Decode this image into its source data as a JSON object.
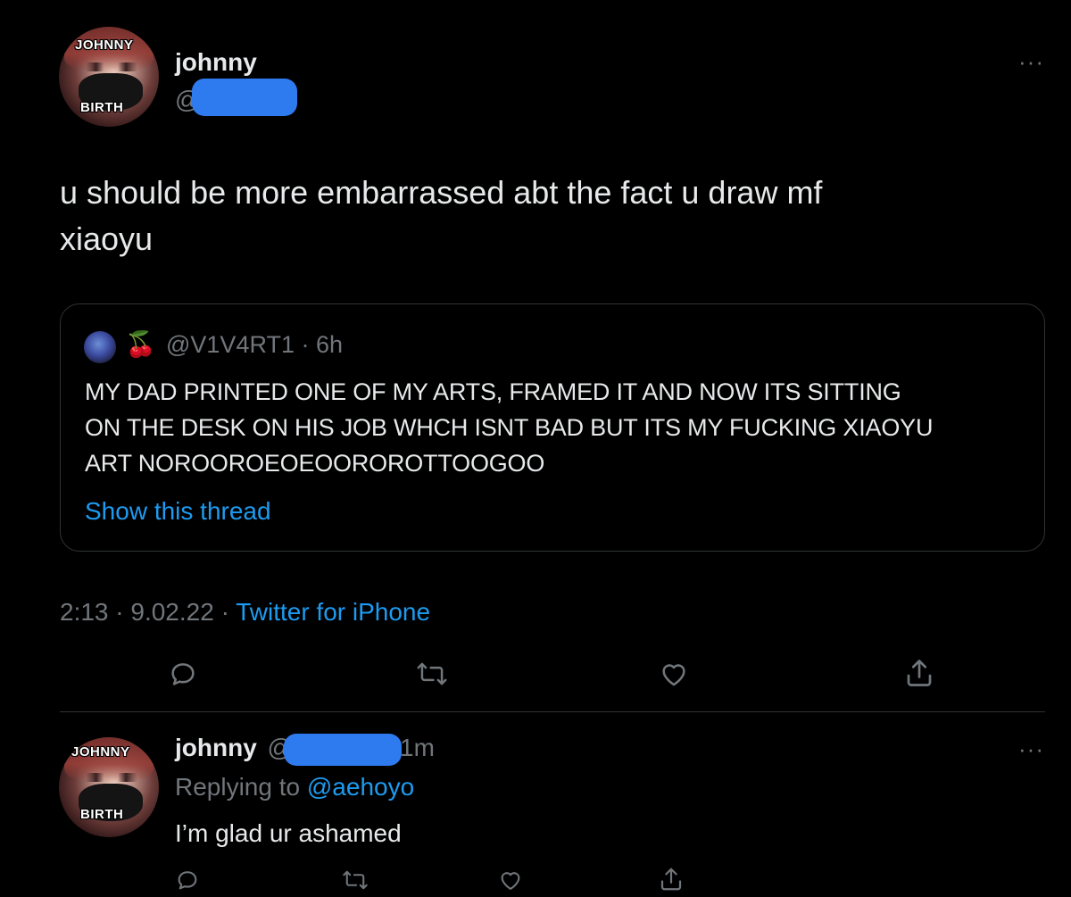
{
  "main_tweet": {
    "avatar_text_top": "JOHNNY",
    "avatar_text_bottom": "BIRTH",
    "display_name": "johnny",
    "handle_prefix": "@",
    "text_line1": "u should be more embarrassed abt the fact u draw mf",
    "text_line2": "xiaoyu",
    "timestamp": "2:13 · 9.02.22 · ",
    "source": "Twitter for iPhone"
  },
  "quoted_tweet": {
    "emoji": "🍒",
    "handle_time": "@V1V4RT1 · 6h",
    "line1": "MY DAD PRINTED ONE OF MY ARTS, FRAMED IT AND NOW ITS SITTING",
    "line2": "ON THE DESK ON HIS JOB WHCH ISNT BAD BUT ITS MY FUCKING XIAOYU",
    "line3": "ART NOROOROEOEOOROROTTOOGOO",
    "show_thread": "Show this thread"
  },
  "reply_tweet": {
    "avatar_text_top": "JOHNNY",
    "avatar_text_bottom": "BIRTH",
    "display_name": "johnny",
    "handle_prefix": "@",
    "time": "1m",
    "replying_prefix": "Replying to ",
    "replying_handle": "@aehoyo",
    "text": "I’m glad ur ashamed"
  },
  "more_menu": "···",
  "colors": {
    "background": "#000000",
    "text": "#e7e9ea",
    "muted": "#71767b",
    "link": "#1d9bf0",
    "border": "#2f3336",
    "redaction": "#2e7bf0"
  },
  "icons": [
    "reply-icon",
    "retweet-icon",
    "like-icon",
    "share-icon",
    "more-icon"
  ]
}
